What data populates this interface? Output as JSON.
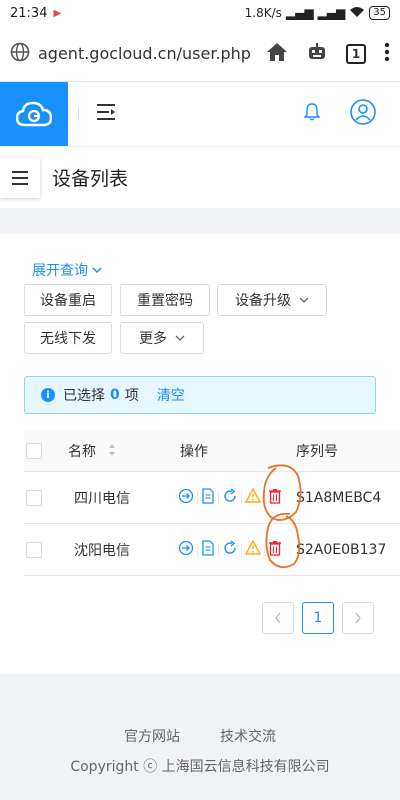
{
  "statusbar": {
    "time": "21:34",
    "net_speed": "1.8K/s",
    "battery": "35"
  },
  "browser": {
    "url": "agent.gocloud.cn/user.php",
    "tab_count": "1"
  },
  "page": {
    "title": "设备列表"
  },
  "toolbar": {
    "expand_query": "展开查询",
    "buttons": [
      "设备重启",
      "重置密码",
      "设备升级",
      "无线下发",
      "更多"
    ]
  },
  "alert": {
    "prefix": "已选择",
    "count": "0",
    "suffix": "项",
    "clear": "清空"
  },
  "table": {
    "headers": {
      "name": "名称",
      "ops": "操作",
      "serial": "序列号"
    },
    "rows": [
      {
        "name": "四川电信",
        "serial": "S1A8MEBC4"
      },
      {
        "name": "沈阳电信",
        "serial": "S2A0E0B137"
      }
    ]
  },
  "pagination": {
    "current": "1"
  },
  "footer": {
    "links": [
      "官方网站",
      "技术交流"
    ],
    "copyright": "Copyright ⓒ 上海国云信息科技有限公司"
  },
  "colors": {
    "primary": "#1890ff",
    "danger": "#f5222d",
    "warning": "#faad14",
    "annotation": "#e8742a"
  },
  "icons": [
    "globe-icon",
    "home-icon",
    "robot-icon",
    "more-vertical-icon",
    "cloud-logo-icon",
    "menu-fold-icon",
    "bell-icon",
    "user-icon",
    "hamburger-icon",
    "chevron-down-icon",
    "info-icon",
    "sort-icon",
    "login-icon",
    "file-icon",
    "refresh-icon",
    "warning-icon",
    "delete-icon"
  ]
}
